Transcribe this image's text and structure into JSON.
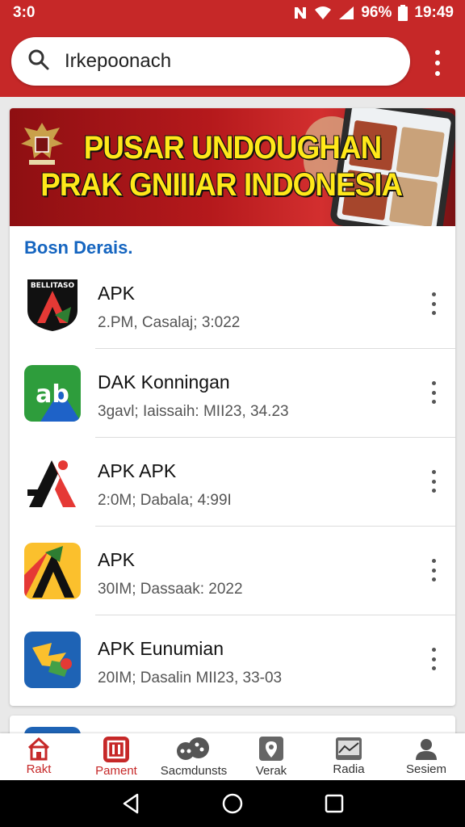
{
  "status_bar": {
    "time_left": "3:0",
    "battery_percent": "96%",
    "clock": "19:49"
  },
  "search": {
    "value": "Irkepoonach",
    "placeholder": "Irkepoonach"
  },
  "banner": {
    "title_line1": "PUSAR UNDOUGHAN",
    "title_line2": "PRAK GNIIIAR INDONESIA"
  },
  "section": {
    "heading": "Bosn Derais."
  },
  "apps": [
    {
      "name": "APK",
      "meta": "2.PM, Casalaj; 3:022",
      "icon": "red-a-shield-icon",
      "icon_label": "BELLITASO"
    },
    {
      "name": "DAK Konningan",
      "meta": "3gavl; Iaissaih: MII23, 34.23",
      "icon": "green-ab-icon",
      "icon_label": "ab"
    },
    {
      "name": "APK APK",
      "meta": "2:0M; Dabala; 4:99I",
      "icon": "red-black-a-icon",
      "icon_label": ""
    },
    {
      "name": "APK",
      "meta": "30IM; Dassaak: 2022",
      "icon": "yellow-a-icon",
      "icon_label": ""
    },
    {
      "name": "APK Eunumian",
      "meta": "20IM; Dasalin MII23, 33-03",
      "icon": "blue-puzzle-icon",
      "icon_label": ""
    }
  ],
  "bottom_nav": [
    {
      "label": "Rakt",
      "icon": "home-icon"
    },
    {
      "label": "Pament",
      "icon": "payment-icon"
    },
    {
      "label": "Sacmdunsts",
      "icon": "community-icon"
    },
    {
      "label": "Verak",
      "icon": "map-pin-icon"
    },
    {
      "label": "Radia",
      "icon": "chart-icon"
    },
    {
      "label": "Sesiem",
      "icon": "profile-icon"
    }
  ],
  "colors": {
    "brand": "#c62828",
    "accent_blue": "#1565c0",
    "banner_text": "#ffe81a"
  }
}
